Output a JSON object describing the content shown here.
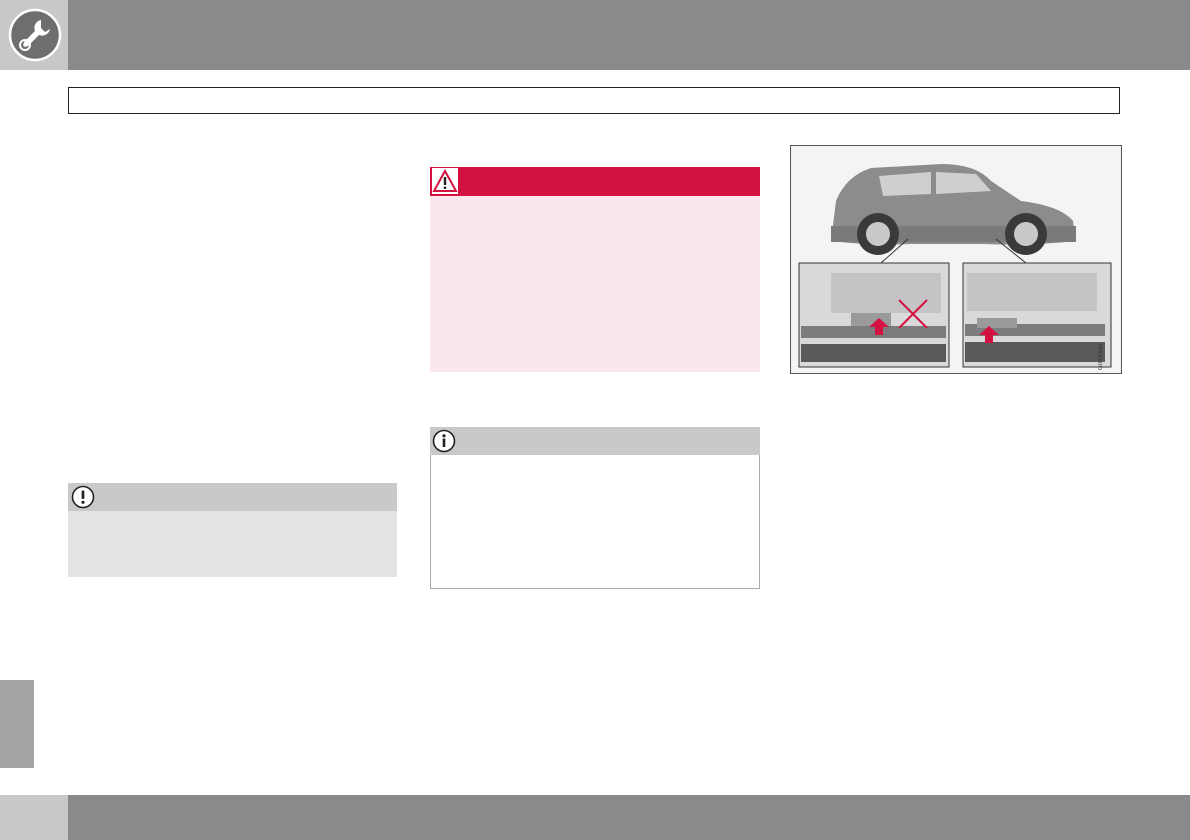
{
  "header": {
    "icon": "wrench-gear-icon",
    "band_color": "#8a8a8c",
    "left_color": "#c8c8c8"
  },
  "title_box": {
    "text": ""
  },
  "caution": {
    "icon": "exclamation-circle-icon",
    "head_color": "#c9c9cb",
    "body_color": "#e3e3e4"
  },
  "warning": {
    "icon": "warning-triangle-icon",
    "head_color": "#d41241",
    "body_color": "#fae6ec"
  },
  "note": {
    "icon": "info-circle-icon",
    "head_color": "#c9c9cb"
  },
  "figure": {
    "code": "G0XXX52",
    "icons": [
      "car-side-view",
      "jack-point-incorrect",
      "jack-point-correct",
      "red-arrow-icon",
      "red-cross-icon"
    ],
    "accent_color": "#d41241"
  },
  "footer": {
    "band_color": "#8a8a8c"
  }
}
